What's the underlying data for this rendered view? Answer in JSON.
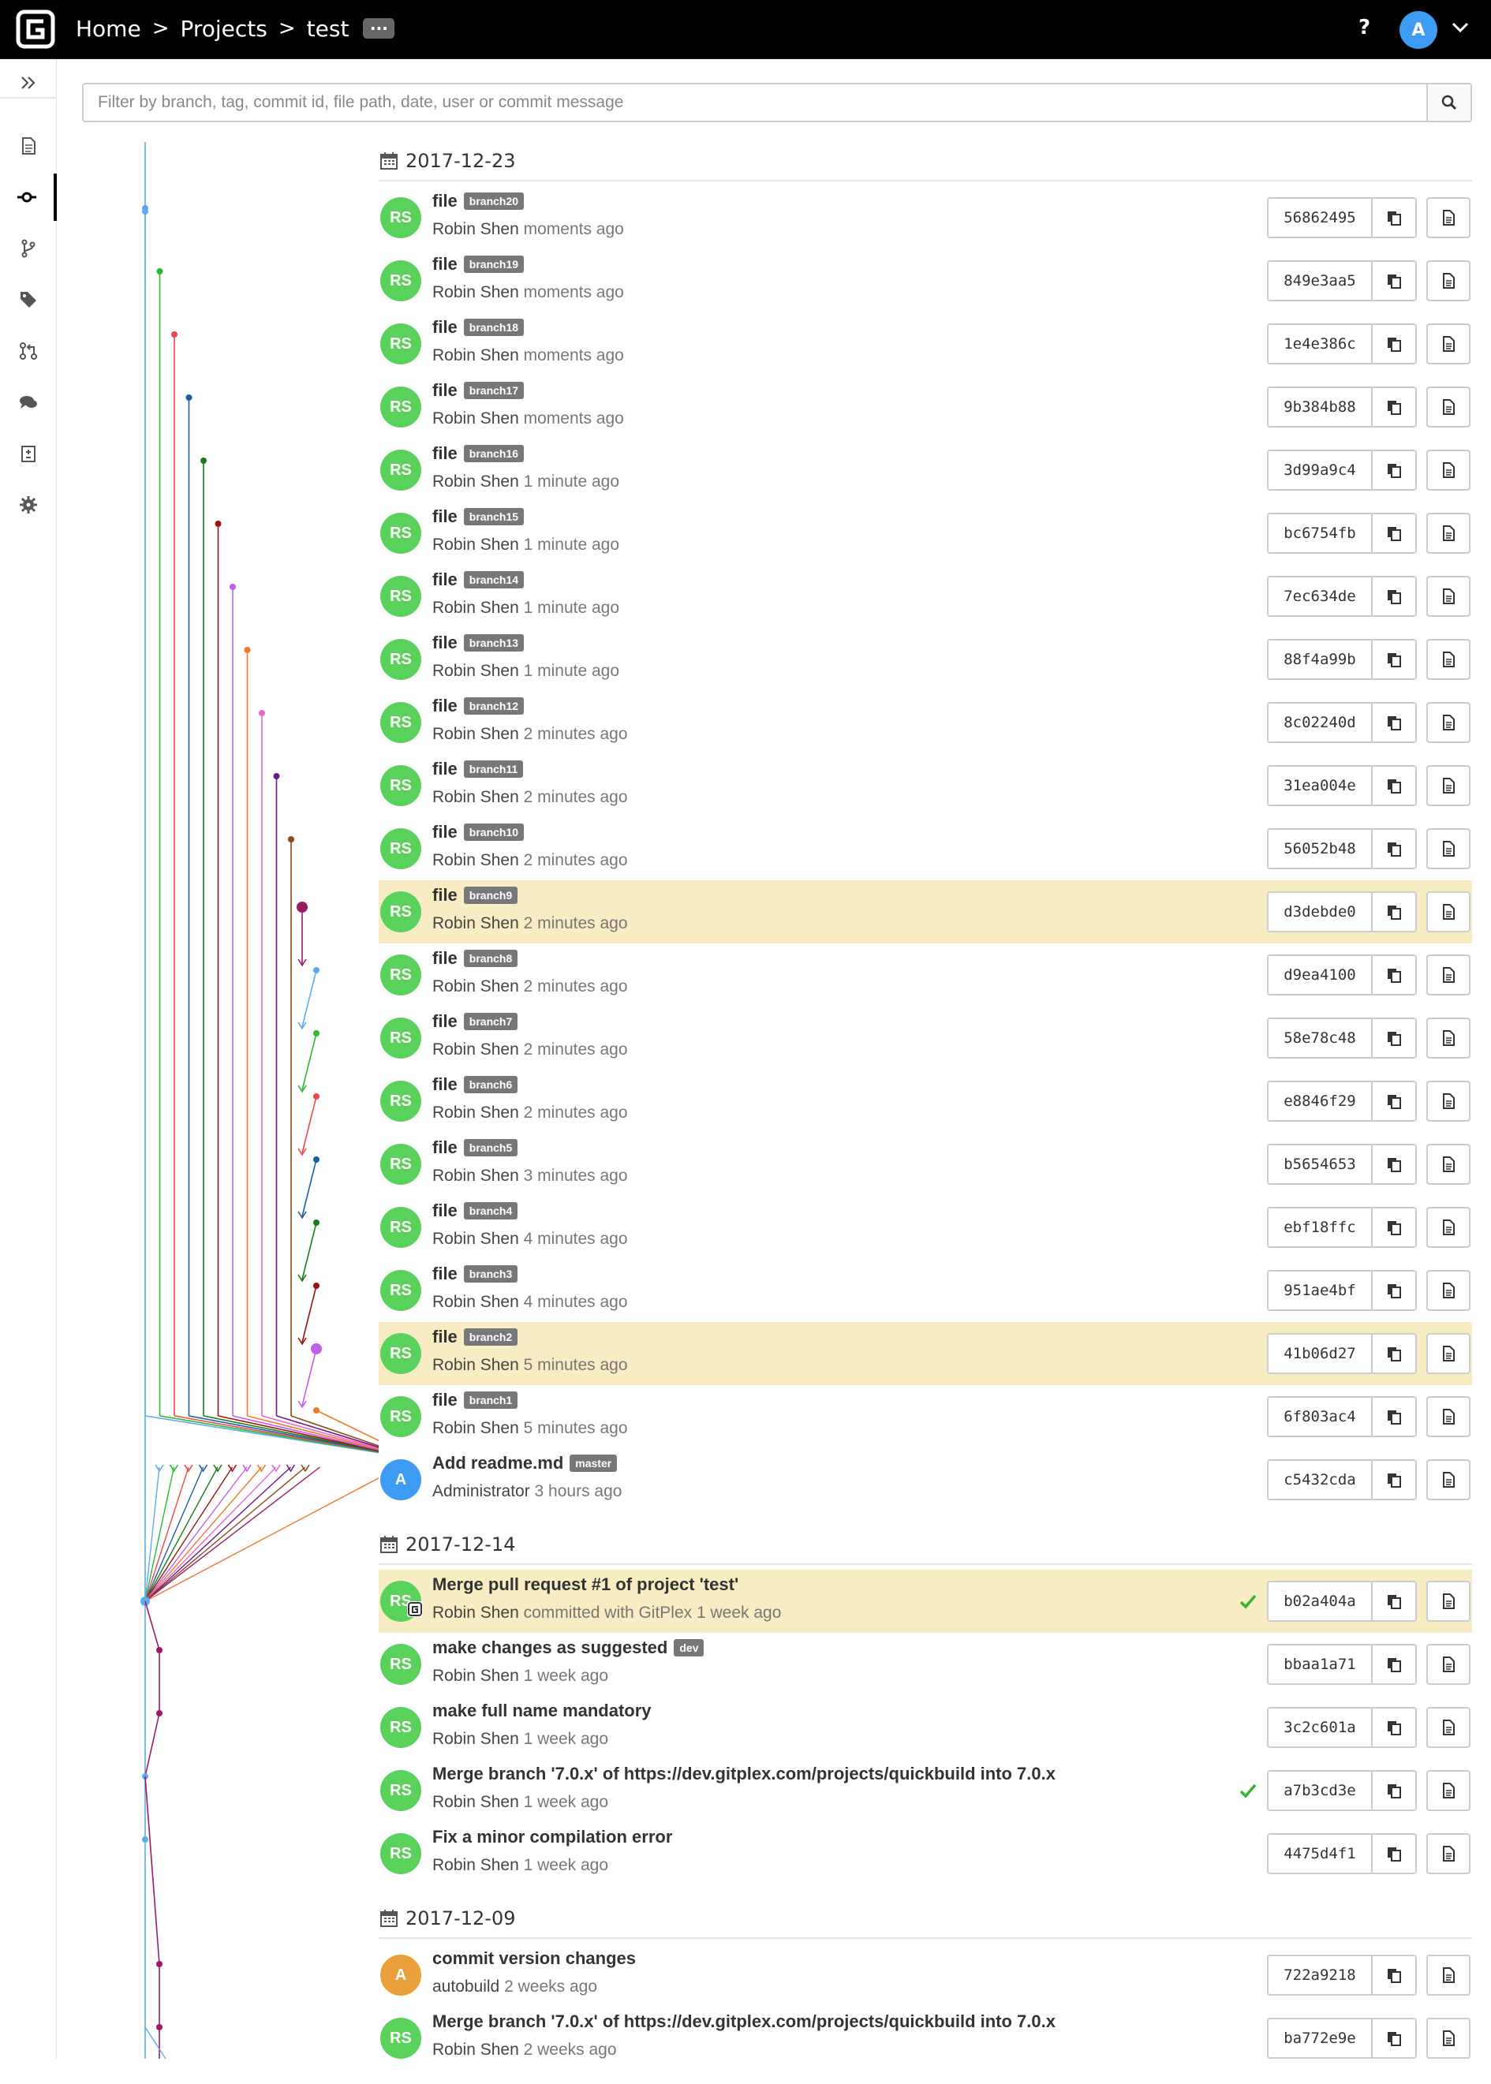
{
  "topbar": {
    "logo": "gitplex-logo",
    "breadcrumbs": [
      "Home",
      "Projects",
      "test"
    ],
    "separator": ">",
    "more_label": "···",
    "help_label": "?",
    "user_initial": "A"
  },
  "sidebar": {
    "items": [
      "files-icon",
      "commits-icon",
      "branches-icon",
      "tags-icon",
      "pull-requests-icon",
      "comments-icon",
      "compare-icon",
      "settings-icon"
    ],
    "active": "commits-icon"
  },
  "filter": {
    "placeholder": "Filter by branch, tag, commit id, file path, date, user or commit message"
  },
  "days": [
    {
      "date": "2017-12-23",
      "commits": [
        {
          "msg": "file",
          "refs": [
            "branch20"
          ],
          "author": "Robin Shen",
          "when": "moments ago",
          "hash": "56862495",
          "initials": "RS",
          "color": "#5ad15a"
        },
        {
          "msg": "file",
          "refs": [
            "branch19"
          ],
          "author": "Robin Shen",
          "when": "moments ago",
          "hash": "849e3aa5",
          "initials": "RS",
          "color": "#5ad15a"
        },
        {
          "msg": "file",
          "refs": [
            "branch18"
          ],
          "author": "Robin Shen",
          "when": "moments ago",
          "hash": "1e4e386c",
          "initials": "RS",
          "color": "#5ad15a"
        },
        {
          "msg": "file",
          "refs": [
            "branch17"
          ],
          "author": "Robin Shen",
          "when": "moments ago",
          "hash": "9b384b88",
          "initials": "RS",
          "color": "#5ad15a"
        },
        {
          "msg": "file",
          "refs": [
            "branch16"
          ],
          "author": "Robin Shen",
          "when": "1 minute ago",
          "hash": "3d99a9c4",
          "initials": "RS",
          "color": "#5ad15a"
        },
        {
          "msg": "file",
          "refs": [
            "branch15"
          ],
          "author": "Robin Shen",
          "when": "1 minute ago",
          "hash": "bc6754fb",
          "initials": "RS",
          "color": "#5ad15a"
        },
        {
          "msg": "file",
          "refs": [
            "branch14"
          ],
          "author": "Robin Shen",
          "when": "1 minute ago",
          "hash": "7ec634de",
          "initials": "RS",
          "color": "#5ad15a"
        },
        {
          "msg": "file",
          "refs": [
            "branch13"
          ],
          "author": "Robin Shen",
          "when": "1 minute ago",
          "hash": "88f4a99b",
          "initials": "RS",
          "color": "#5ad15a"
        },
        {
          "msg": "file",
          "refs": [
            "branch12"
          ],
          "author": "Robin Shen",
          "when": "2 minutes ago",
          "hash": "8c02240d",
          "initials": "RS",
          "color": "#5ad15a"
        },
        {
          "msg": "file",
          "refs": [
            "branch11"
          ],
          "author": "Robin Shen",
          "when": "2 minutes ago",
          "hash": "31ea004e",
          "initials": "RS",
          "color": "#5ad15a"
        },
        {
          "msg": "file",
          "refs": [
            "branch10"
          ],
          "author": "Robin Shen",
          "when": "2 minutes ago",
          "hash": "56052b48",
          "initials": "RS",
          "color": "#5ad15a"
        },
        {
          "msg": "file",
          "refs": [
            "branch9"
          ],
          "author": "Robin Shen",
          "when": "2 minutes ago",
          "hash": "d3debde0",
          "initials": "RS",
          "color": "#5ad15a",
          "highlight": true
        },
        {
          "msg": "file",
          "refs": [
            "branch8"
          ],
          "author": "Robin Shen",
          "when": "2 minutes ago",
          "hash": "d9ea4100",
          "initials": "RS",
          "color": "#5ad15a"
        },
        {
          "msg": "file",
          "refs": [
            "branch7"
          ],
          "author": "Robin Shen",
          "when": "2 minutes ago",
          "hash": "58e78c48",
          "initials": "RS",
          "color": "#5ad15a"
        },
        {
          "msg": "file",
          "refs": [
            "branch6"
          ],
          "author": "Robin Shen",
          "when": "2 minutes ago",
          "hash": "e8846f29",
          "initials": "RS",
          "color": "#5ad15a"
        },
        {
          "msg": "file",
          "refs": [
            "branch5"
          ],
          "author": "Robin Shen",
          "when": "3 minutes ago",
          "hash": "b5654653",
          "initials": "RS",
          "color": "#5ad15a"
        },
        {
          "msg": "file",
          "refs": [
            "branch4"
          ],
          "author": "Robin Shen",
          "when": "4 minutes ago",
          "hash": "ebf18ffc",
          "initials": "RS",
          "color": "#5ad15a"
        },
        {
          "msg": "file",
          "refs": [
            "branch3"
          ],
          "author": "Robin Shen",
          "when": "4 minutes ago",
          "hash": "951ae4bf",
          "initials": "RS",
          "color": "#5ad15a"
        },
        {
          "msg": "file",
          "refs": [
            "branch2"
          ],
          "author": "Robin Shen",
          "when": "5 minutes ago",
          "hash": "41b06d27",
          "initials": "RS",
          "color": "#5ad15a",
          "highlight": true
        },
        {
          "msg": "file",
          "refs": [
            "branch1"
          ],
          "author": "Robin Shen",
          "when": "5 minutes ago",
          "hash": "6f803ac4",
          "initials": "RS",
          "color": "#5ad15a"
        },
        {
          "msg": "Add readme.md",
          "refs": [
            "master"
          ],
          "author": "Administrator",
          "when": "3 hours ago",
          "hash": "c5432cda",
          "initials": "A",
          "color": "#3d9bf2"
        }
      ]
    },
    {
      "date": "2017-12-14",
      "commits": [
        {
          "msg": "Merge pull request #1 of project 'test'",
          "refs": [],
          "author": "Robin Shen",
          "committer": "committed with GitPlex",
          "when": "1 week ago",
          "hash": "b02a404a",
          "initials": "RS",
          "color": "#5ad15a",
          "highlight": true,
          "verified": true,
          "gitplex_badge": true
        },
        {
          "msg": "make changes as suggested",
          "refs": [
            "dev"
          ],
          "author": "Robin Shen",
          "when": "1 week ago",
          "hash": "bbaa1a71",
          "initials": "RS",
          "color": "#5ad15a"
        },
        {
          "msg": "make full name mandatory",
          "refs": [],
          "author": "Robin Shen",
          "when": "1 week ago",
          "hash": "3c2c601a",
          "initials": "RS",
          "color": "#5ad15a"
        },
        {
          "msg": "Merge branch '7.0.x' of https://dev.gitplex.com/projects/quickbuild into 7.0.x",
          "refs": [],
          "author": "Robin Shen",
          "when": "1 week ago",
          "hash": "a7b3cd3e",
          "initials": "RS",
          "color": "#5ad15a",
          "verified": true
        },
        {
          "msg": "Fix a minor compilation error",
          "refs": [],
          "author": "Robin Shen",
          "when": "1 week ago",
          "hash": "4475d4f1",
          "initials": "RS",
          "color": "#5ad15a"
        }
      ]
    },
    {
      "date": "2017-12-09",
      "commits": [
        {
          "msg": "commit version changes",
          "refs": [],
          "author": "autobuild",
          "when": "2 weeks ago",
          "hash": "722a9218",
          "initials": "A",
          "color": "#eaa03a"
        },
        {
          "msg": "Merge branch '7.0.x' of https://dev.gitplex.com/projects/quickbuild into 7.0.x",
          "refs": [],
          "author": "Robin Shen",
          "when": "2 weeks ago",
          "hash": "ba772e9e",
          "initials": "RS",
          "color": "#5ad15a"
        }
      ]
    }
  ],
  "graph_colors": [
    "#5aabf0",
    "#2db82d",
    "#f04848",
    "#1c5ca8",
    "#1c7a1c",
    "#a01010",
    "#c060e8",
    "#f07828",
    "#e868d0",
    "#6a1a8a",
    "#8a4a1a",
    "#9a1a6a"
  ]
}
